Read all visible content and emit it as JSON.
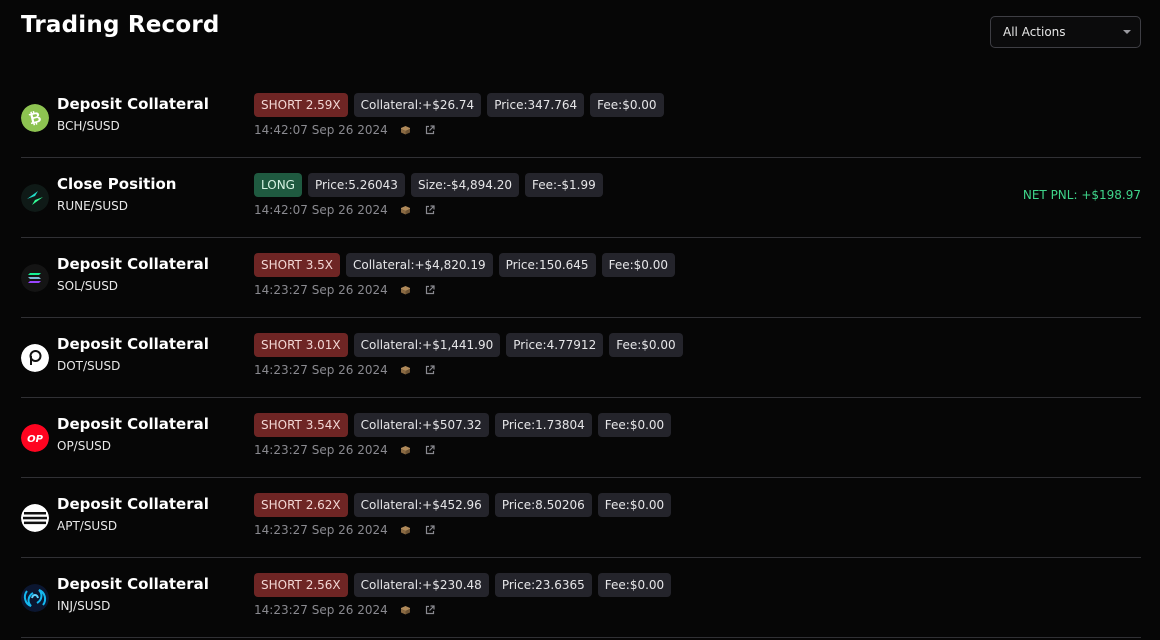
{
  "page": {
    "title": "Trading Record"
  },
  "filter": {
    "selected": "All Actions"
  },
  "records": [
    {
      "coin": "BCH",
      "coin_color": "#8dc351",
      "action": "Deposit Collateral",
      "pair": "BCH/SUSD",
      "side": "SHORT 2.59X",
      "side_type": "short",
      "fields": [
        "Collateral:+$26.74",
        "Price:347.764",
        "Fee:$0.00"
      ],
      "time": "14:42:07 Sep 26 2024",
      "pnl": ""
    },
    {
      "coin": "RUNE",
      "coin_color": "#0f1a17",
      "action": "Close Position",
      "pair": "RUNE/SUSD",
      "side": "LONG",
      "side_type": "long",
      "fields": [
        "Price:5.26043",
        "Size:-$4,894.20",
        "Fee:-$1.99"
      ],
      "time": "14:42:07 Sep 26 2024",
      "pnl": "NET PNL: +$198.97"
    },
    {
      "coin": "SOL",
      "coin_color": "#141414",
      "action": "Deposit Collateral",
      "pair": "SOL/SUSD",
      "side": "SHORT 3.5X",
      "side_type": "short",
      "fields": [
        "Collateral:+$4,820.19",
        "Price:150.645",
        "Fee:$0.00"
      ],
      "time": "14:23:27 Sep 26 2024",
      "pnl": ""
    },
    {
      "coin": "DOT",
      "coin_color": "#ffffff",
      "action": "Deposit Collateral",
      "pair": "DOT/SUSD",
      "side": "SHORT 3.01X",
      "side_type": "short",
      "fields": [
        "Collateral:+$1,441.90",
        "Price:4.77912",
        "Fee:$0.00"
      ],
      "time": "14:23:27 Sep 26 2024",
      "pnl": ""
    },
    {
      "coin": "OP",
      "coin_color": "#ff0420",
      "action": "Deposit Collateral",
      "pair": "OP/SUSD",
      "side": "SHORT 3.54X",
      "side_type": "short",
      "fields": [
        "Collateral:+$507.32",
        "Price:1.73804",
        "Fee:$0.00"
      ],
      "time": "14:23:27 Sep 26 2024",
      "pnl": ""
    },
    {
      "coin": "APT",
      "coin_color": "#ffffff",
      "action": "Deposit Collateral",
      "pair": "APT/SUSD",
      "side": "SHORT 2.62X",
      "side_type": "short",
      "fields": [
        "Collateral:+$452.96",
        "Price:8.50206",
        "Fee:$0.00"
      ],
      "time": "14:23:27 Sep 26 2024",
      "pnl": ""
    },
    {
      "coin": "INJ",
      "coin_color": "#0082fa",
      "action": "Deposit Collateral",
      "pair": "INJ/SUSD",
      "side": "SHORT 2.56X",
      "side_type": "short",
      "fields": [
        "Collateral:+$230.48",
        "Price:23.6365",
        "Fee:$0.00"
      ],
      "time": "14:23:27 Sep 26 2024",
      "pnl": ""
    }
  ]
}
